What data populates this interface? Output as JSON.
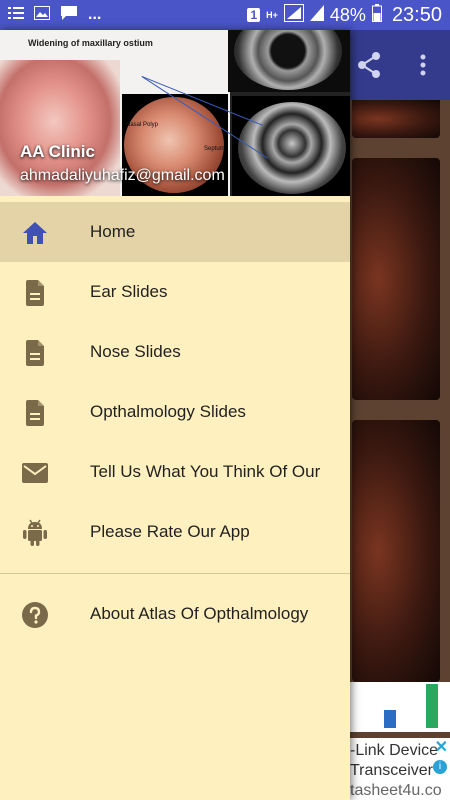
{
  "status_bar": {
    "time": "23:50",
    "battery": "48%",
    "sim_badge": "1",
    "network": "H+",
    "left_icons": [
      "menu-icon",
      "image-icon",
      "chat-icon",
      "more-dots-icon"
    ],
    "dots": "..."
  },
  "drawer": {
    "header": {
      "name": "AA Clinic",
      "email": "ahmadaliyuhafiz@gmail.com",
      "image_label": "Widening of maxillary ostium",
      "endo_label_1": "Nasal Polyp",
      "endo_label_2": "Septum"
    },
    "items": [
      {
        "label": "Home",
        "icon": "home-icon",
        "active": true
      },
      {
        "label": "Ear Slides",
        "icon": "document-icon"
      },
      {
        "label": "Nose Slides",
        "icon": "document-icon"
      },
      {
        "label": "Opthalmology Slides",
        "icon": "document-icon"
      },
      {
        "label": "Tell Us What You Think Of Our",
        "icon": "mail-icon"
      },
      {
        "label": "Please Rate Our App",
        "icon": "android-icon"
      }
    ],
    "footer_items": [
      {
        "label": "About Atlas Of Opthalmology",
        "icon": "help-icon"
      }
    ]
  },
  "toolbar": {
    "actions": [
      "share-icon",
      "overflow-menu-icon"
    ]
  },
  "ad": {
    "line1": "-Link Device",
    "line2": "Transceiver",
    "line3": "tasheet4u.co"
  },
  "colors": {
    "status_bar": "#4a55c8",
    "toolbar": "#343b8c",
    "drawer_bg": "#fff0c0",
    "active_item": "#e3d3a7",
    "home_icon": "#3f51b5",
    "menu_icon": "#7a6a4a"
  }
}
